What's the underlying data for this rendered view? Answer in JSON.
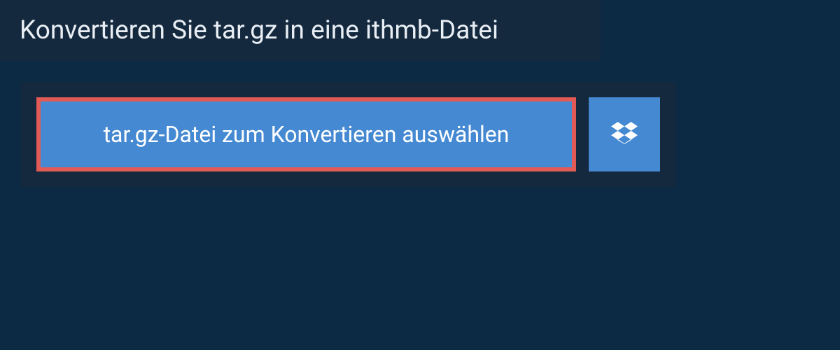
{
  "header": {
    "title": "Konvertieren Sie tar.gz in eine ithmb-Datei"
  },
  "actions": {
    "select_file_label": "tar.gz-Datei zum Konvertieren auswählen"
  }
}
